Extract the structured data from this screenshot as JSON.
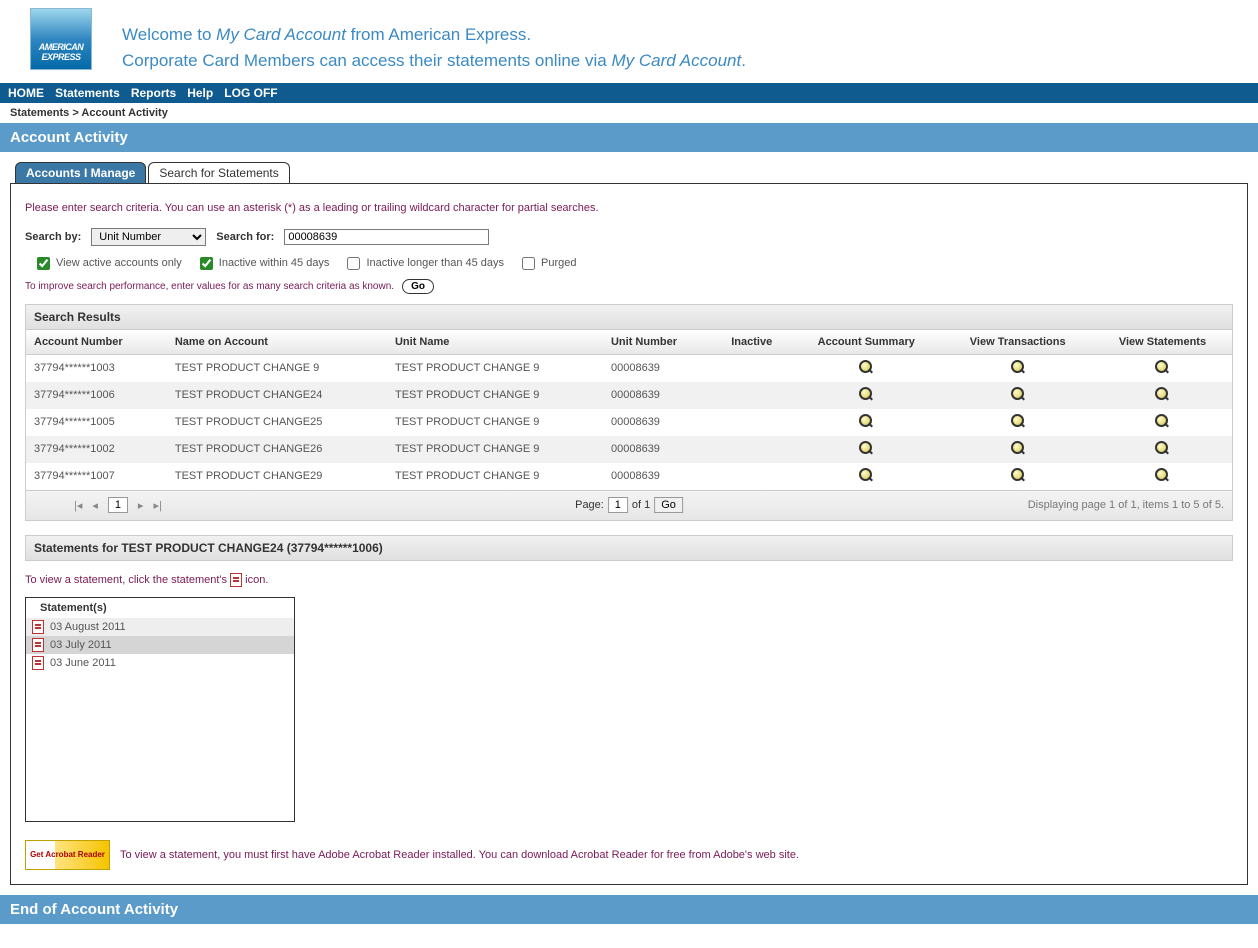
{
  "brand": {
    "line1": "AMERICAN",
    "line2": "EXPRESS"
  },
  "welcome": {
    "part1": "Welcome to ",
    "italic1": "My Card Account",
    "part2": " from American Express.",
    "line2a": "Corporate Card Members can access their statements online via ",
    "italic2": "My Card Account",
    "line2b": "."
  },
  "nav": {
    "home": "HOME",
    "statements": "Statements",
    "reports": "Reports",
    "help": "Help",
    "logoff": "LOG OFF"
  },
  "breadcrumb": "Statements > Account Activity",
  "page_title": "Account Activity",
  "tabs": {
    "active": "Accounts I Manage",
    "inactive": "Search for Statements"
  },
  "instructions": "Please enter search criteria. You can use an asterisk (*) as a leading or trailing wildcard character for partial searches.",
  "search": {
    "by_label": "Search by:",
    "by_value": "Unit Number",
    "for_label": "Search for:",
    "for_value": "00008639"
  },
  "checkboxes": {
    "active_only": "View active accounts only",
    "inactive_45": "Inactive within 45 days",
    "inactive_longer": "Inactive longer than 45 days",
    "purged": "Purged"
  },
  "perf_hint": "To improve search performance, enter values for as many search criteria as known.",
  "go": "Go",
  "grid_title": "Search Results",
  "columns": {
    "acct_num": "Account Number",
    "name": "Name on Account",
    "unit_name": "Unit Name",
    "unit_num": "Unit Number",
    "inactive": "Inactive",
    "acct_summary": "Account Summary",
    "view_txn": "View Transactions",
    "view_stmt": "View Statements"
  },
  "rows": [
    {
      "acct": "37794******1003",
      "name": "TEST PRODUCT CHANGE 9",
      "unit_name": "TEST PRODUCT CHANGE 9",
      "unit_num": "00008639"
    },
    {
      "acct": "37794******1006",
      "name": "TEST PRODUCT CHANGE24",
      "unit_name": "TEST PRODUCT CHANGE 9",
      "unit_num": "00008639"
    },
    {
      "acct": "37794******1005",
      "name": "TEST PRODUCT CHANGE25",
      "unit_name": "TEST PRODUCT CHANGE 9",
      "unit_num": "00008639"
    },
    {
      "acct": "37794******1002",
      "name": "TEST PRODUCT CHANGE26",
      "unit_name": "TEST PRODUCT CHANGE 9",
      "unit_num": "00008639"
    },
    {
      "acct": "37794******1007",
      "name": "TEST PRODUCT CHANGE29",
      "unit_name": "TEST PRODUCT CHANGE 9",
      "unit_num": "00008639"
    }
  ],
  "pager": {
    "page_label": "Page:",
    "page_value": "1",
    "of_text": "of 1",
    "go": "Go",
    "display": "Displaying page 1 of 1, items 1 to 5 of 5.",
    "nav_box": "1"
  },
  "stmt_header": "Statements for TEST PRODUCT CHANGE24 (37794******1006)",
  "stmt_note_a": "To view a statement, click the statement's ",
  "stmt_note_b": " icon.",
  "stmt_box_title": "Statement(s)",
  "statements": [
    {
      "label": "03 August 2011"
    },
    {
      "label": "03 July 2011"
    },
    {
      "label": "03 June 2011"
    }
  ],
  "acrobat": {
    "badge": "Get Acrobat Reader",
    "text": "To view a statement, you must first have Adobe Acrobat Reader installed. You can download Acrobat Reader for free from Adobe's web site."
  },
  "footer": "End of Account Activity"
}
